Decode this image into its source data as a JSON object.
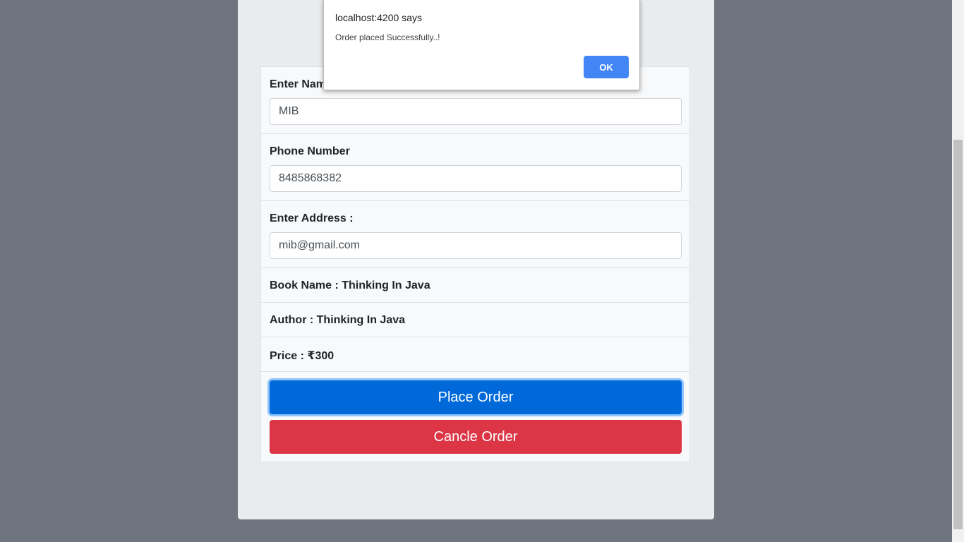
{
  "dialog": {
    "title": "localhost:4200 says",
    "message": "Order placed Successfully..!",
    "ok_label": "OK"
  },
  "form": {
    "name": {
      "label": "Enter Name :",
      "value": "MIB"
    },
    "phone": {
      "label": "Phone Number",
      "value": "8485868382"
    },
    "address": {
      "label": "Enter Address :",
      "value": "mib@gmail.com"
    },
    "book_name": "Book Name : Thinking In Java",
    "author": "Author : Thinking In Java",
    "price": "Price : ₹300",
    "place_order_label": "Place Order",
    "cancel_order_label": "Cancle Order"
  },
  "colors": {
    "primary": "#0069d9",
    "danger": "#dc3545",
    "dialog_button": "#4285f4",
    "backdrop": "#6f757e"
  }
}
